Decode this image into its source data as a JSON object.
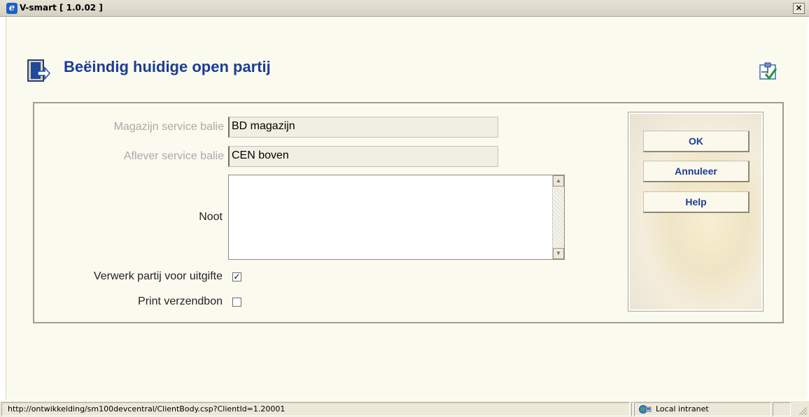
{
  "window": {
    "title": "V-smart [ 1.0.02 ]",
    "close_label": "×"
  },
  "page": {
    "title": "Beëindig huidige open partij"
  },
  "form": {
    "magazijn_label": "Magazijn service balie",
    "magazijn_value": "BD magazijn",
    "aflever_label": "Aflever service balie",
    "aflever_value": "CEN boven",
    "noot_label": "Noot",
    "noot_value": "",
    "verwerk_label": "Verwerk partij voor uitgifte",
    "verwerk_checked": true,
    "print_label": "Print verzendbon",
    "print_checked": false
  },
  "buttons": {
    "ok": "OK",
    "annuleer": "Annuleer",
    "help": "Help"
  },
  "statusbar": {
    "url": "http://ontwikkelding/sm100devcentral/ClientBody.csp?ClientId=1.20001",
    "zone": "Local intranet"
  }
}
